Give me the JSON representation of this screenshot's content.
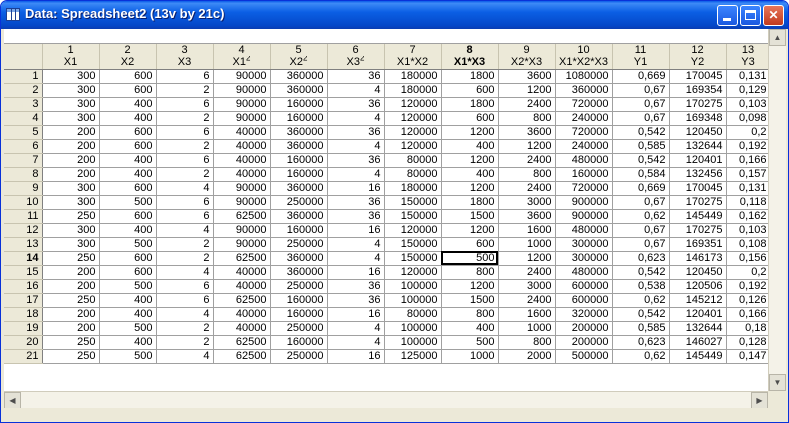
{
  "window": {
    "title": "Data: Spreadsheet2 (13v by 21c)",
    "buttons": {
      "minimize": "_",
      "maximize": "□",
      "close": "✕"
    },
    "icon": "spreadsheet-icon"
  },
  "columns": [
    {
      "num": "1",
      "name": "X1",
      "sup": ""
    },
    {
      "num": "2",
      "name": "X2",
      "sup": ""
    },
    {
      "num": "3",
      "name": "X3",
      "sup": ""
    },
    {
      "num": "4",
      "name": "X1",
      "sup": "2"
    },
    {
      "num": "5",
      "name": "X2",
      "sup": "2"
    },
    {
      "num": "6",
      "name": "X3",
      "sup": "2"
    },
    {
      "num": "7",
      "name": "X1*X2",
      "sup": ""
    },
    {
      "num": "8",
      "name": "X1*X3",
      "sup": "",
      "bold": true
    },
    {
      "num": "9",
      "name": "X2*X3",
      "sup": ""
    },
    {
      "num": "10",
      "name": "X1*X2*X3",
      "sup": ""
    },
    {
      "num": "11",
      "name": "Y1",
      "sup": ""
    },
    {
      "num": "12",
      "name": "Y2",
      "sup": ""
    },
    {
      "num": "13",
      "name": "Y3",
      "sup": ""
    }
  ],
  "rows": [
    [
      "300",
      "600",
      "6",
      "90000",
      "360000",
      "36",
      "180000",
      "1800",
      "3600",
      "1080000",
      "0,669",
      "170045",
      "0,131"
    ],
    [
      "300",
      "600",
      "2",
      "90000",
      "360000",
      "4",
      "180000",
      "600",
      "1200",
      "360000",
      "0,67",
      "169354",
      "0,129"
    ],
    [
      "300",
      "400",
      "6",
      "90000",
      "160000",
      "36",
      "120000",
      "1800",
      "2400",
      "720000",
      "0,67",
      "170275",
      "0,103"
    ],
    [
      "300",
      "400",
      "2",
      "90000",
      "160000",
      "4",
      "120000",
      "600",
      "800",
      "240000",
      "0,67",
      "169348",
      "0,098"
    ],
    [
      "200",
      "600",
      "6",
      "40000",
      "360000",
      "36",
      "120000",
      "1200",
      "3600",
      "720000",
      "0,542",
      "120450",
      "0,2"
    ],
    [
      "200",
      "600",
      "2",
      "40000",
      "360000",
      "4",
      "120000",
      "400",
      "1200",
      "240000",
      "0,585",
      "132644",
      "0,192"
    ],
    [
      "200",
      "400",
      "6",
      "40000",
      "160000",
      "36",
      "80000",
      "1200",
      "2400",
      "480000",
      "0,542",
      "120401",
      "0,166"
    ],
    [
      "200",
      "400",
      "2",
      "40000",
      "160000",
      "4",
      "80000",
      "400",
      "800",
      "160000",
      "0,584",
      "132456",
      "0,157"
    ],
    [
      "300",
      "600",
      "4",
      "90000",
      "360000",
      "16",
      "180000",
      "1200",
      "2400",
      "720000",
      "0,669",
      "170045",
      "0,131"
    ],
    [
      "300",
      "500",
      "6",
      "90000",
      "250000",
      "36",
      "150000",
      "1800",
      "3000",
      "900000",
      "0,67",
      "170275",
      "0,118"
    ],
    [
      "250",
      "600",
      "6",
      "62500",
      "360000",
      "36",
      "150000",
      "1500",
      "3600",
      "900000",
      "0,62",
      "145449",
      "0,162"
    ],
    [
      "300",
      "400",
      "4",
      "90000",
      "160000",
      "16",
      "120000",
      "1200",
      "1600",
      "480000",
      "0,67",
      "170275",
      "0,103"
    ],
    [
      "300",
      "500",
      "2",
      "90000",
      "250000",
      "4",
      "150000",
      "600",
      "1000",
      "300000",
      "0,67",
      "169351",
      "0,108"
    ],
    [
      "250",
      "600",
      "2",
      "62500",
      "360000",
      "4",
      "150000",
      "500",
      "1200",
      "300000",
      "0,623",
      "146173",
      "0,156"
    ],
    [
      "200",
      "600",
      "4",
      "40000",
      "360000",
      "16",
      "120000",
      "800",
      "2400",
      "480000",
      "0,542",
      "120450",
      "0,2"
    ],
    [
      "200",
      "500",
      "6",
      "40000",
      "250000",
      "36",
      "100000",
      "1200",
      "3000",
      "600000",
      "0,538",
      "120506",
      "0,192"
    ],
    [
      "250",
      "400",
      "6",
      "62500",
      "160000",
      "36",
      "100000",
      "1500",
      "2400",
      "600000",
      "0,62",
      "145212",
      "0,126"
    ],
    [
      "200",
      "400",
      "4",
      "40000",
      "160000",
      "16",
      "80000",
      "800",
      "1600",
      "320000",
      "0,542",
      "120401",
      "0,166"
    ],
    [
      "200",
      "500",
      "2",
      "40000",
      "250000",
      "4",
      "100000",
      "400",
      "1000",
      "200000",
      "0,585",
      "132644",
      "0,18"
    ],
    [
      "250",
      "400",
      "2",
      "62500",
      "160000",
      "4",
      "100000",
      "500",
      "800",
      "200000",
      "0,623",
      "146027",
      "0,128"
    ],
    [
      "250",
      "500",
      "4",
      "62500",
      "250000",
      "16",
      "125000",
      "1000",
      "2000",
      "500000",
      "0,62",
      "145449",
      "0,147"
    ]
  ],
  "active_row": 14,
  "active_col": 8
}
